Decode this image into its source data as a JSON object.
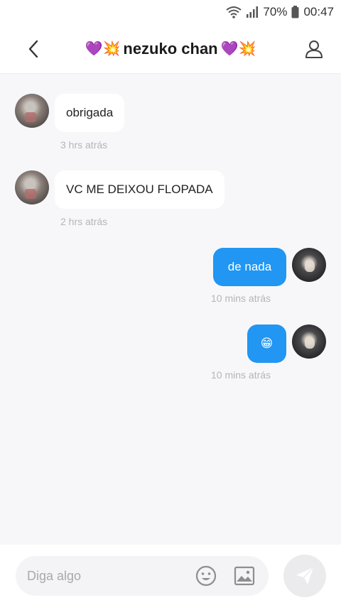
{
  "status": {
    "battery_percent": "70%",
    "time": "00:47"
  },
  "header": {
    "title": "nezuko chan",
    "emoji_left": "💜💥",
    "emoji_right": "💜💥"
  },
  "messages": [
    {
      "direction": "in",
      "text": "obrigada",
      "time": "3 hrs atrás"
    },
    {
      "direction": "in",
      "text": "VC ME DEIXOU FLOPADA",
      "time": "2 hrs atrás"
    },
    {
      "direction": "out",
      "text": "de nada",
      "time": "10 mins atrás"
    },
    {
      "direction": "out",
      "text": "😁",
      "time": "10 mins atrás"
    }
  ],
  "composer": {
    "placeholder": "Diga algo"
  },
  "colors": {
    "accent": "#2196f3",
    "background": "#f7f7f9",
    "timestamp": "#b5b5b8"
  },
  "icons": [
    "wifi-icon",
    "signal-icon",
    "battery-icon",
    "back-icon",
    "profile-icon",
    "emoji-icon",
    "image-icon",
    "send-icon"
  ]
}
